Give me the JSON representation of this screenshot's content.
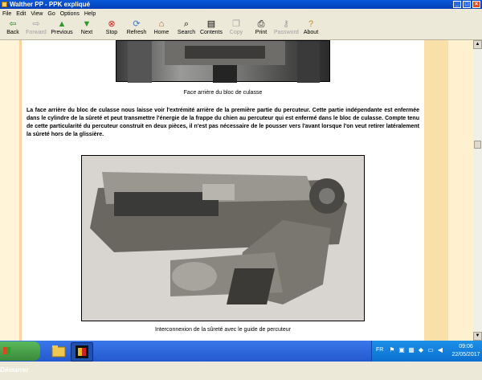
{
  "window": {
    "title": "Walther PP - PPK expliqué"
  },
  "menu": [
    "File",
    "Edit",
    "View",
    "Go",
    "Options",
    "Help"
  ],
  "toolbar": {
    "back": "Back",
    "forward": "Forward",
    "previous": "Previous",
    "next": "Next",
    "stop": "Stop",
    "refresh": "Refresh",
    "home": "Home",
    "search": "Search",
    "contents": "Contents",
    "copy": "Copy",
    "print": "Print",
    "password": "Password",
    "about": "About"
  },
  "page": {
    "caption1": "Face arrière du bloc de culasse",
    "paragraph": "La face arrière du bloc de culasse nous laisse voir l'extrémité arrière de la première partie du percuteur. Cette partie indépendante est enfermée dans le cylindre de la sûreté et peut transmettre l'énergie de la frappe du chien au percuteur qui est enfermé dans le bloc de culasse. Compte tenu de cette particularité du percuteur construit en deux pièces, il n'est pas nécessaire de le pousser vers l'avant lorsque l'on veut retirer latéralement la sûreté hors de la glissière.",
    "caption2": "Interconnexion de la sûreté avec le guide de percuteur"
  },
  "taskbar": {
    "start": "Démarrer",
    "language": "FR",
    "time": "09:06",
    "date": "22/05/2017"
  }
}
